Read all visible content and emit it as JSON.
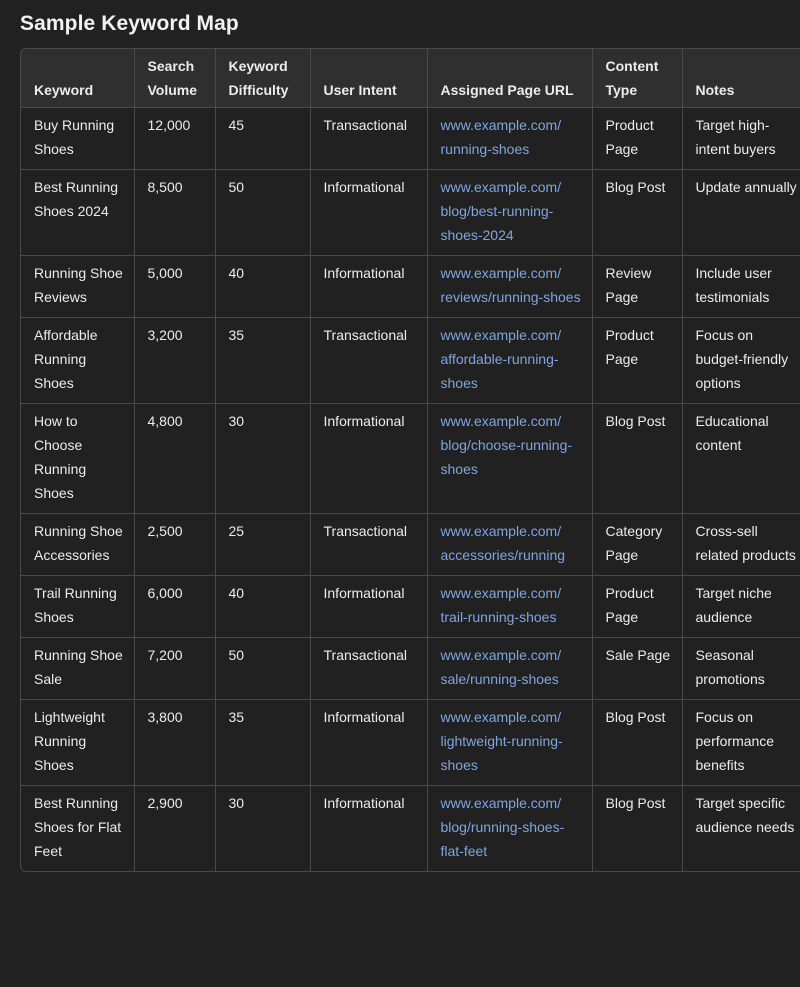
{
  "title": "Sample Keyword Map",
  "colors": {
    "background": "#212121",
    "header_background": "#2f2f2f",
    "border": "#4a4a4a",
    "text": "#ececec",
    "link": "#7ea6e0"
  },
  "table": {
    "headers": [
      "Keyword",
      "Search Volume",
      "Keyword Difficulty",
      "User Intent",
      "Assigned Page URL",
      "Content Type",
      "Notes"
    ],
    "rows": [
      {
        "keyword": "Buy Running Shoes",
        "volume": "12,000",
        "difficulty": "45",
        "intent": "Transactional",
        "url": "www.example.com/ running-shoes",
        "content_type": "Product Page",
        "notes": "Target high-intent buyers"
      },
      {
        "keyword": "Best Running Shoes 2024",
        "volume": "8,500",
        "difficulty": "50",
        "intent": "Informational",
        "url": "www.example.com/ blog/best-running-shoes-2024",
        "content_type": "Blog Post",
        "notes": "Update annually"
      },
      {
        "keyword": "Running Shoe Reviews",
        "volume": "5,000",
        "difficulty": "40",
        "intent": "Informational",
        "url": "www.example.com/ reviews/running-shoes",
        "content_type": "Review Page",
        "notes": "Include user testimonials"
      },
      {
        "keyword": "Affordable Running Shoes",
        "volume": "3,200",
        "difficulty": "35",
        "intent": "Transactional",
        "url": "www.example.com/ affordable-running-shoes",
        "content_type": "Product Page",
        "notes": "Focus on budget-friendly options"
      },
      {
        "keyword": "How to Choose Running Shoes",
        "volume": "4,800",
        "difficulty": "30",
        "intent": "Informational",
        "url": "www.example.com/ blog/choose-running-shoes",
        "content_type": "Blog Post",
        "notes": "Educational content"
      },
      {
        "keyword": "Running Shoe Accessories",
        "volume": "2,500",
        "difficulty": "25",
        "intent": "Transactional",
        "url": "www.example.com/ accessories/running",
        "content_type": "Category Page",
        "notes": "Cross-sell related products"
      },
      {
        "keyword": "Trail Running Shoes",
        "volume": "6,000",
        "difficulty": "40",
        "intent": "Informational",
        "url": "www.example.com/ trail-running-shoes",
        "content_type": "Product Page",
        "notes": "Target niche audience"
      },
      {
        "keyword": "Running Shoe Sale",
        "volume": "7,200",
        "difficulty": "50",
        "intent": "Transactional",
        "url": "www.example.com/ sale/running-shoes",
        "content_type": "Sale Page",
        "notes": "Seasonal promotions"
      },
      {
        "keyword": "Lightweight Running Shoes",
        "volume": "3,800",
        "difficulty": "35",
        "intent": "Informational",
        "url": "www.example.com/ lightweight-running-shoes",
        "content_type": "Blog Post",
        "notes": "Focus on performance benefits"
      },
      {
        "keyword": "Best Running Shoes for Flat Feet",
        "volume": "2,900",
        "difficulty": "30",
        "intent": "Informational",
        "url": "www.example.com/ blog/running-shoes-flat-feet",
        "content_type": "Blog Post",
        "notes": "Target specific audience needs"
      }
    ]
  }
}
